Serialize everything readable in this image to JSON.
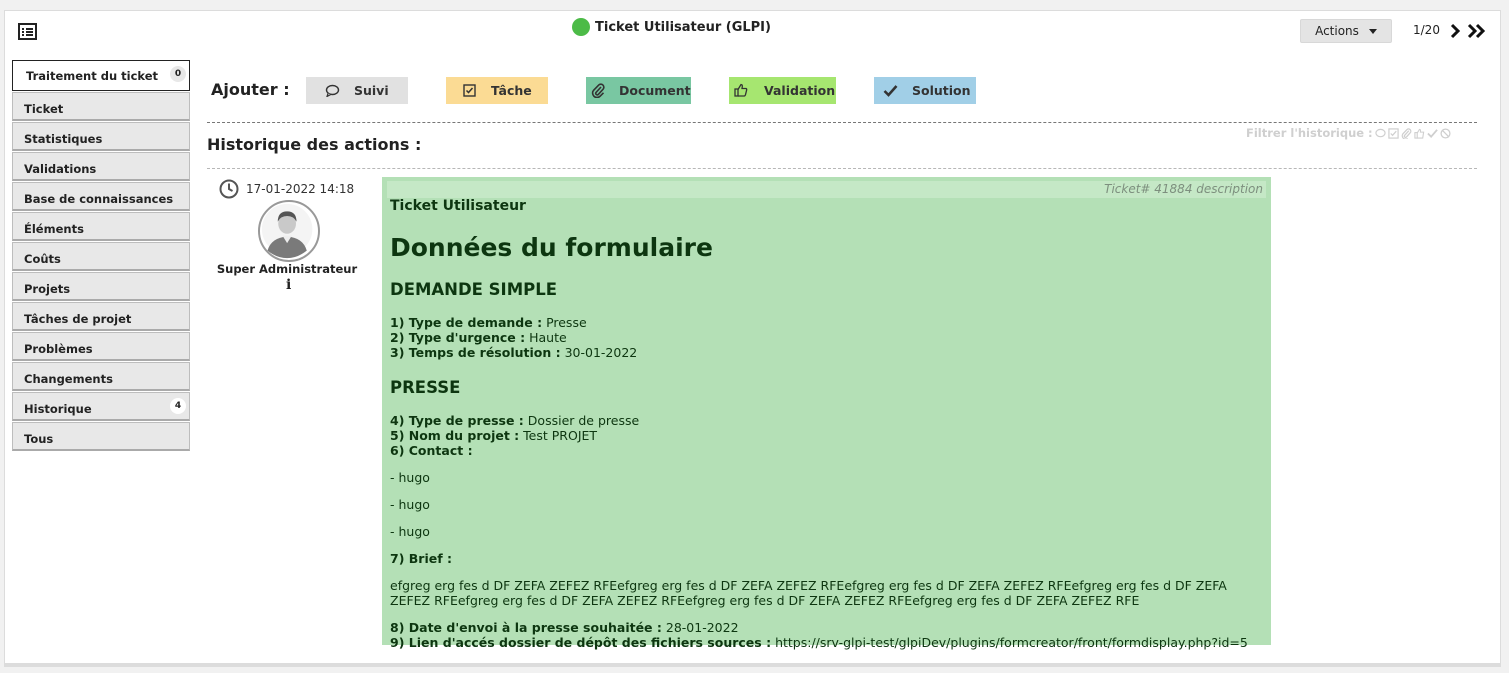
{
  "header": {
    "title": "Ticket Utilisateur (GLPI)",
    "actions_label": "Actions",
    "pager": "1/20",
    "status_color": "#4cbb47"
  },
  "tabs": [
    {
      "label": "Traitement du ticket",
      "badge": "0",
      "active": true
    },
    {
      "label": "Ticket"
    },
    {
      "label": "Statistiques"
    },
    {
      "label": "Validations"
    },
    {
      "label": "Base de connaissances"
    },
    {
      "label": "Éléments"
    },
    {
      "label": "Coûts"
    },
    {
      "label": "Projets"
    },
    {
      "label": "Tâches de projet"
    },
    {
      "label": "Problèmes"
    },
    {
      "label": "Changements"
    },
    {
      "label": "Historique",
      "badge": "4"
    },
    {
      "label": "Tous"
    }
  ],
  "add": {
    "label": "Ajouter :",
    "buttons": [
      {
        "label": "Suivi",
        "icon": "comment-icon",
        "color": "#e1e1e1"
      },
      {
        "label": "Tâche",
        "icon": "checkbox-icon",
        "color": "#fbdb94"
      },
      {
        "label": "Document",
        "icon": "paperclip-icon",
        "color": "#79c7a2"
      },
      {
        "label": "Validation",
        "icon": "thumbs-up-icon",
        "color": "#a6e670"
      },
      {
        "label": "Solution",
        "icon": "check-icon",
        "color": "#a1cfe7"
      }
    ]
  },
  "history": {
    "title": "Historique des actions :",
    "filter_label": "Filtrer l'historique :"
  },
  "entry": {
    "date": "17-01-2022 14:18",
    "user": "Super Administrateur",
    "info": "i",
    "ref": "Ticket# 41884 description",
    "subtitle": "Ticket Utilisateur",
    "form_title": "Données du formulaire",
    "section1": "DEMANDE SIMPLE",
    "s1_items": [
      {
        "label": "1) Type de demande :",
        "value": "Presse"
      },
      {
        "label": "2) Type d'urgence :",
        "value": "Haute"
      },
      {
        "label": "3) Temps de résolution :",
        "value": "30-01-2022"
      }
    ],
    "section2": "PRESSE",
    "s2_items": [
      {
        "label": "4) Type de presse :",
        "value": "Dossier de presse"
      },
      {
        "label": "5) Nom du projet :",
        "value": "Test PROJET"
      },
      {
        "label": "6) Contact :",
        "value": ""
      }
    ],
    "contacts": [
      "- hugo",
      "- hugo",
      "- hugo"
    ],
    "brief_label": "7) Brief :",
    "brief_text": "efgreg erg fes d DF ZEFA ZEFEZ RFEefgreg erg fes d DF ZEFA ZEFEZ RFEefgreg erg fes d DF ZEFA ZEFEZ RFEefgreg erg fes d DF ZEFA ZEFEZ RFEefgreg erg fes d DF ZEFA ZEFEZ RFEefgreg erg fes d DF ZEFA ZEFEZ RFEefgreg erg fes d DF ZEFA ZEFEZ RFE",
    "s3_items": [
      {
        "label": "8) Date d'envoi à la presse souhaitée :",
        "value": "28-01-2022"
      },
      {
        "label": "9) Lien d'accés dossier de dépôt des fichiers sources :",
        "value": "https://srv-glpi-test/glpiDev/plugins/formcreator/front/formdisplay.php?id=5"
      }
    ]
  }
}
